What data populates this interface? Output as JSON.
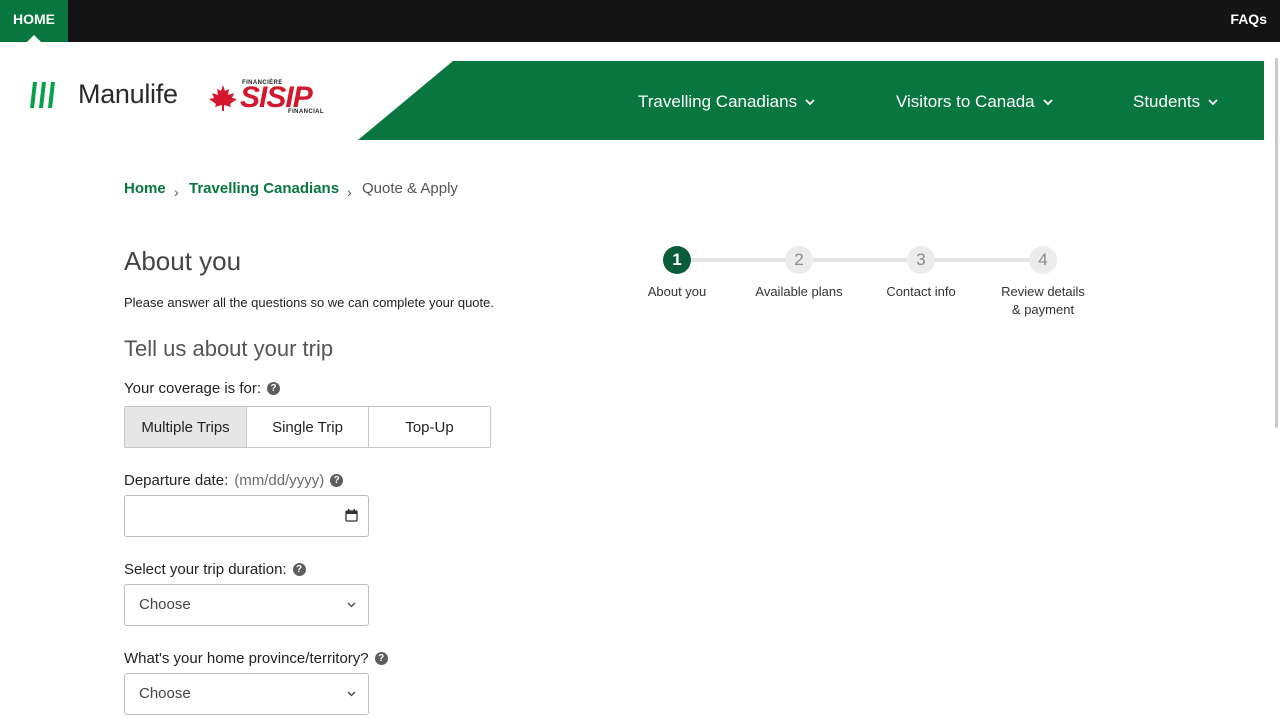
{
  "topbar": {
    "home_label": "HOME",
    "faqs_label": "FAQs"
  },
  "brand": {
    "name": "Manulife",
    "partner_top": "FINANCIÈRE",
    "partner_name": "SISIP",
    "partner_bottom": "FINANCIAL",
    "green": "#08773f",
    "red": "#d4172c"
  },
  "nav": {
    "items": [
      {
        "label": "Travelling Canadians"
      },
      {
        "label": "Visitors to Canada"
      },
      {
        "label": "Students"
      }
    ]
  },
  "breadcrumb": {
    "home": "Home",
    "section": "Travelling Canadians",
    "current": "Quote & Apply"
  },
  "form": {
    "title": "About you",
    "intro": "Please answer all the questions so we can complete your quote.",
    "trip_heading": "Tell us about your trip",
    "coverage_label": "Your coverage is for:",
    "coverage_options": [
      "Multiple Trips",
      "Single Trip",
      "Top-Up"
    ],
    "coverage_selected": "Multiple Trips",
    "departure_label": "Departure date:",
    "departure_hint": "(mm/dd/yyyy)",
    "departure_value": "",
    "duration_label": "Select your trip duration:",
    "duration_value": "Choose",
    "province_label": "What's your home province/territory?",
    "province_value": "Choose"
  },
  "stepper": {
    "steps": [
      {
        "number": "1",
        "label": "About you",
        "active": true
      },
      {
        "number": "2",
        "label": "Available plans",
        "active": false
      },
      {
        "number": "3",
        "label": "Contact info",
        "active": false
      },
      {
        "number": "4",
        "label": "Review details & payment",
        "active": false
      }
    ]
  }
}
